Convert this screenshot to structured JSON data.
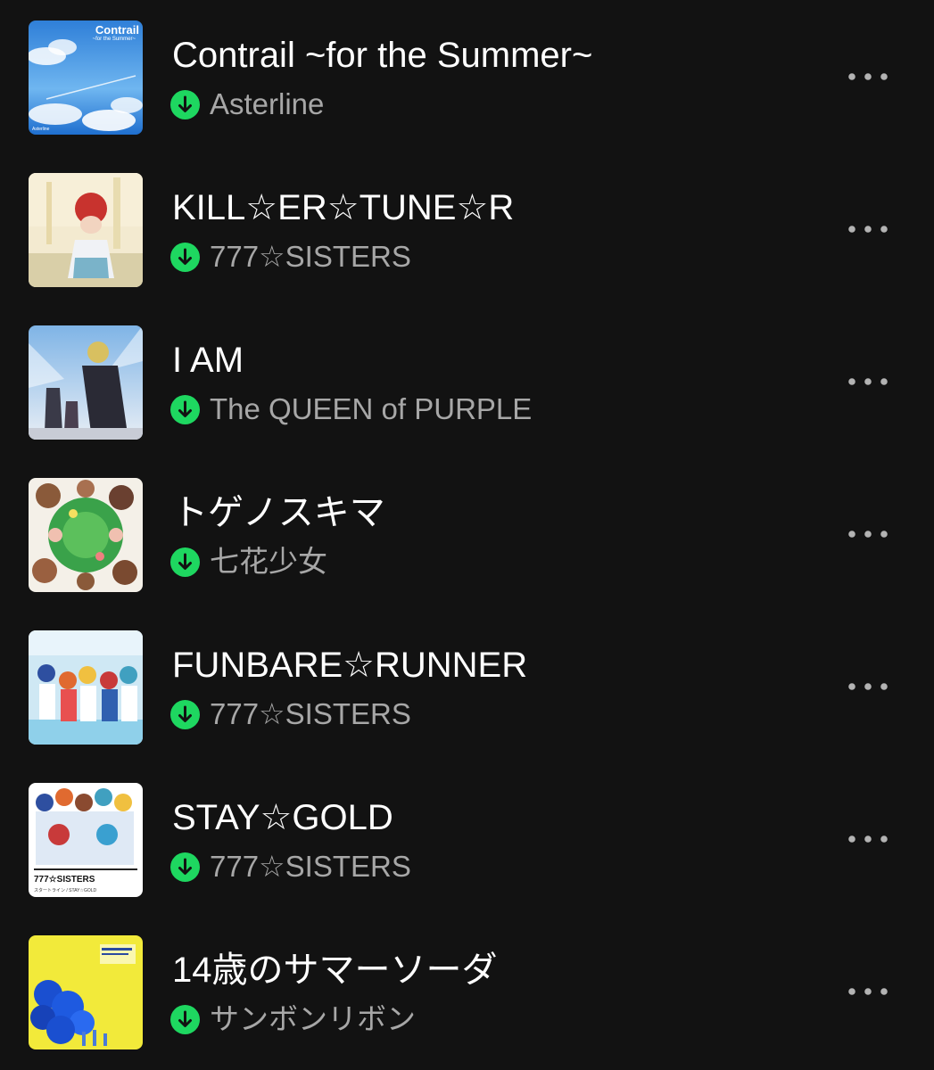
{
  "tracks": [
    {
      "title": "Contrail ~for the Summer~",
      "artist": "Asterline",
      "downloaded": true,
      "cover_text": [
        "Contrail",
        "~for the Summer~",
        "Asterline"
      ]
    },
    {
      "title": "KILL☆ER☆TUNE☆R",
      "artist": "777☆SISTERS",
      "downloaded": true
    },
    {
      "title": "I AM",
      "artist": "The QUEEN of PURPLE",
      "downloaded": true
    },
    {
      "title": "トゲノスキマ",
      "artist": "七花少女",
      "downloaded": true
    },
    {
      "title": "FUNBARE☆RUNNER",
      "artist": "777☆SISTERS",
      "downloaded": true
    },
    {
      "title": "STAY☆GOLD",
      "artist": "777☆SISTERS",
      "downloaded": true,
      "cover_text": [
        "777☆SISTERS",
        "スタートライン / STAY☆GOLD"
      ]
    },
    {
      "title": "14歳のサマーソーダ",
      "artist": "サンボンリボン",
      "downloaded": true
    },
    {
      "more_icon": "more-horizontal-icon",
      "download_icon": "downloaded-icon"
    }
  ],
  "colors": {
    "background": "#121212",
    "title": "#ffffff",
    "subtitle": "#a7a7a7",
    "download_accent": "#1ed760"
  }
}
